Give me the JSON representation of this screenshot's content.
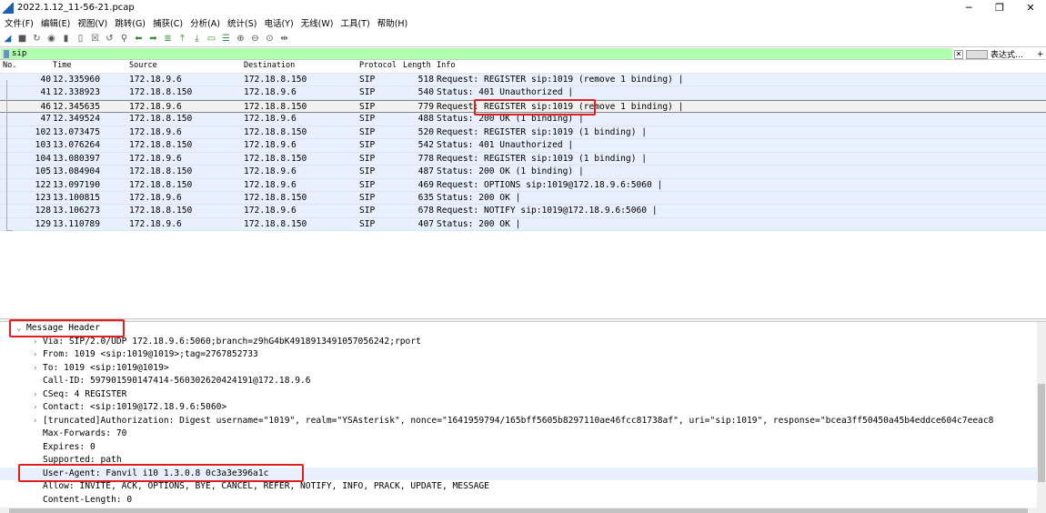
{
  "window": {
    "title": "2022.1.12_11-56-21.pcap",
    "minimize": "─",
    "maximize": "❐",
    "close": "✕"
  },
  "menu": [
    "文件(F)",
    "编辑(E)",
    "视图(V)",
    "跳转(G)",
    "捕获(C)",
    "分析(A)",
    "统计(S)",
    "电话(Y)",
    "无线(W)",
    "工具(T)",
    "帮助(H)"
  ],
  "toolbar_icons": [
    "shark-fin-start-icon",
    "stop-icon",
    "restart-icon",
    "options-icon",
    "open-icon",
    "save-icon",
    "close-file-icon",
    "reload-icon",
    "find-icon",
    "back-icon",
    "forward-icon",
    "goto-icon",
    "first-icon",
    "last-icon",
    "autoscroll-icon",
    "colorize-icon",
    "zoom-in-icon",
    "zoom-out-icon",
    "zoom-reset-icon",
    "resize-columns-icon"
  ],
  "filter": {
    "value": "sip",
    "expression_label": "表达式…",
    "add_label": "+",
    "clear": "✕"
  },
  "columns": {
    "no": "No.",
    "time": "Time",
    "source": "Source",
    "destination": "Destination",
    "protocol": "Protocol",
    "length": "Length",
    "info": "Info"
  },
  "packets": [
    {
      "no": "40",
      "time": "12.335960",
      "src": "172.18.9.6",
      "dst": "172.18.8.150",
      "proto": "SIP",
      "len": "518",
      "info": "Request: REGISTER sip:1019  (remove 1 binding) |"
    },
    {
      "no": "41",
      "time": "12.338923",
      "src": "172.18.8.150",
      "dst": "172.18.9.6",
      "proto": "SIP",
      "len": "540",
      "info": "Status: 401 Unauthorized |"
    },
    {
      "no": "46",
      "time": "12.345635",
      "src": "172.18.9.6",
      "dst": "172.18.8.150",
      "proto": "SIP",
      "len": "779",
      "info": "Request: REGISTER sip:1019  (remove 1 binding) |",
      "selected": true
    },
    {
      "no": "47",
      "time": "12.349524",
      "src": "172.18.8.150",
      "dst": "172.18.9.6",
      "proto": "SIP",
      "len": "488",
      "info": "Status: 200 OK  (1 binding) |"
    },
    {
      "no": "102",
      "time": "13.073475",
      "src": "172.18.9.6",
      "dst": "172.18.8.150",
      "proto": "SIP",
      "len": "520",
      "info": "Request: REGISTER sip:1019  (1 binding) |"
    },
    {
      "no": "103",
      "time": "13.076264",
      "src": "172.18.8.150",
      "dst": "172.18.9.6",
      "proto": "SIP",
      "len": "542",
      "info": "Status: 401 Unauthorized |"
    },
    {
      "no": "104",
      "time": "13.080397",
      "src": "172.18.9.6",
      "dst": "172.18.8.150",
      "proto": "SIP",
      "len": "778",
      "info": "Request: REGISTER sip:1019  (1 binding) |"
    },
    {
      "no": "105",
      "time": "13.084904",
      "src": "172.18.8.150",
      "dst": "172.18.9.6",
      "proto": "SIP",
      "len": "487",
      "info": "Status: 200 OK  (1 binding) |"
    },
    {
      "no": "122",
      "time": "13.097190",
      "src": "172.18.8.150",
      "dst": "172.18.9.6",
      "proto": "SIP",
      "len": "469",
      "info": "Request: OPTIONS sip:1019@172.18.9.6:5060 |"
    },
    {
      "no": "123",
      "time": "13.100815",
      "src": "172.18.9.6",
      "dst": "172.18.8.150",
      "proto": "SIP",
      "len": "635",
      "info": "Status: 200 OK |"
    },
    {
      "no": "128",
      "time": "13.106273",
      "src": "172.18.8.150",
      "dst": "172.18.9.6",
      "proto": "SIP",
      "len": "678",
      "info": "Request: NOTIFY sip:1019@172.18.9.6:5060 |"
    },
    {
      "no": "129",
      "time": "13.110789",
      "src": "172.18.9.6",
      "dst": "172.18.8.150",
      "proto": "SIP",
      "len": "407",
      "info": "Status: 200 OK |"
    }
  ],
  "details": [
    {
      "indent": 0,
      "toggle": "⌄",
      "text": "Message Header"
    },
    {
      "indent": 1,
      "toggle": "›",
      "text": "Via: SIP/2.0/UDP 172.18.9.6:5060;branch=z9hG4bK4918913491057056242;rport"
    },
    {
      "indent": 1,
      "toggle": "›",
      "text": "From: 1019 <sip:1019@1019>;tag=2767852733"
    },
    {
      "indent": 1,
      "toggle": "›",
      "text": "To: 1019 <sip:1019@1019>"
    },
    {
      "indent": 1,
      "toggle": "",
      "text": "Call-ID: 597901590147414-560302620424191@172.18.9.6"
    },
    {
      "indent": 1,
      "toggle": "›",
      "text": "CSeq: 4 REGISTER"
    },
    {
      "indent": 1,
      "toggle": "›",
      "text": "Contact: <sip:1019@172.18.9.6:5060>"
    },
    {
      "indent": 1,
      "toggle": "›",
      "text": " [truncated]Authorization: Digest username=\"1019\", realm=\"YSAsterisk\", nonce=\"1641959794/165bff5605b8297110ae46fcc81738af\", uri=\"sip:1019\", response=\"bcea3ff50450a45b4eddce604c7eeac8"
    },
    {
      "indent": 1,
      "toggle": "",
      "text": "Max-Forwards: 70"
    },
    {
      "indent": 1,
      "toggle": "",
      "text": "Expires: 0"
    },
    {
      "indent": 1,
      "toggle": "",
      "text": "Supported: path"
    },
    {
      "indent": 1,
      "toggle": "",
      "text": "User-Agent: Fanvil i10 1.3.0.8 0c3a3e396a1c",
      "highlighted": true
    },
    {
      "indent": 1,
      "toggle": "",
      "text": "Allow: INVITE, ACK, OPTIONS, BYE, CANCEL, REFER, NOTIFY, INFO, PRACK, UPDATE, MESSAGE"
    },
    {
      "indent": 1,
      "toggle": "",
      "text": "Content-Length: 0"
    }
  ],
  "colors": {
    "filter_valid": "#afffaf",
    "row_bg": "#e7f0fc",
    "annotation": "#e02020"
  }
}
